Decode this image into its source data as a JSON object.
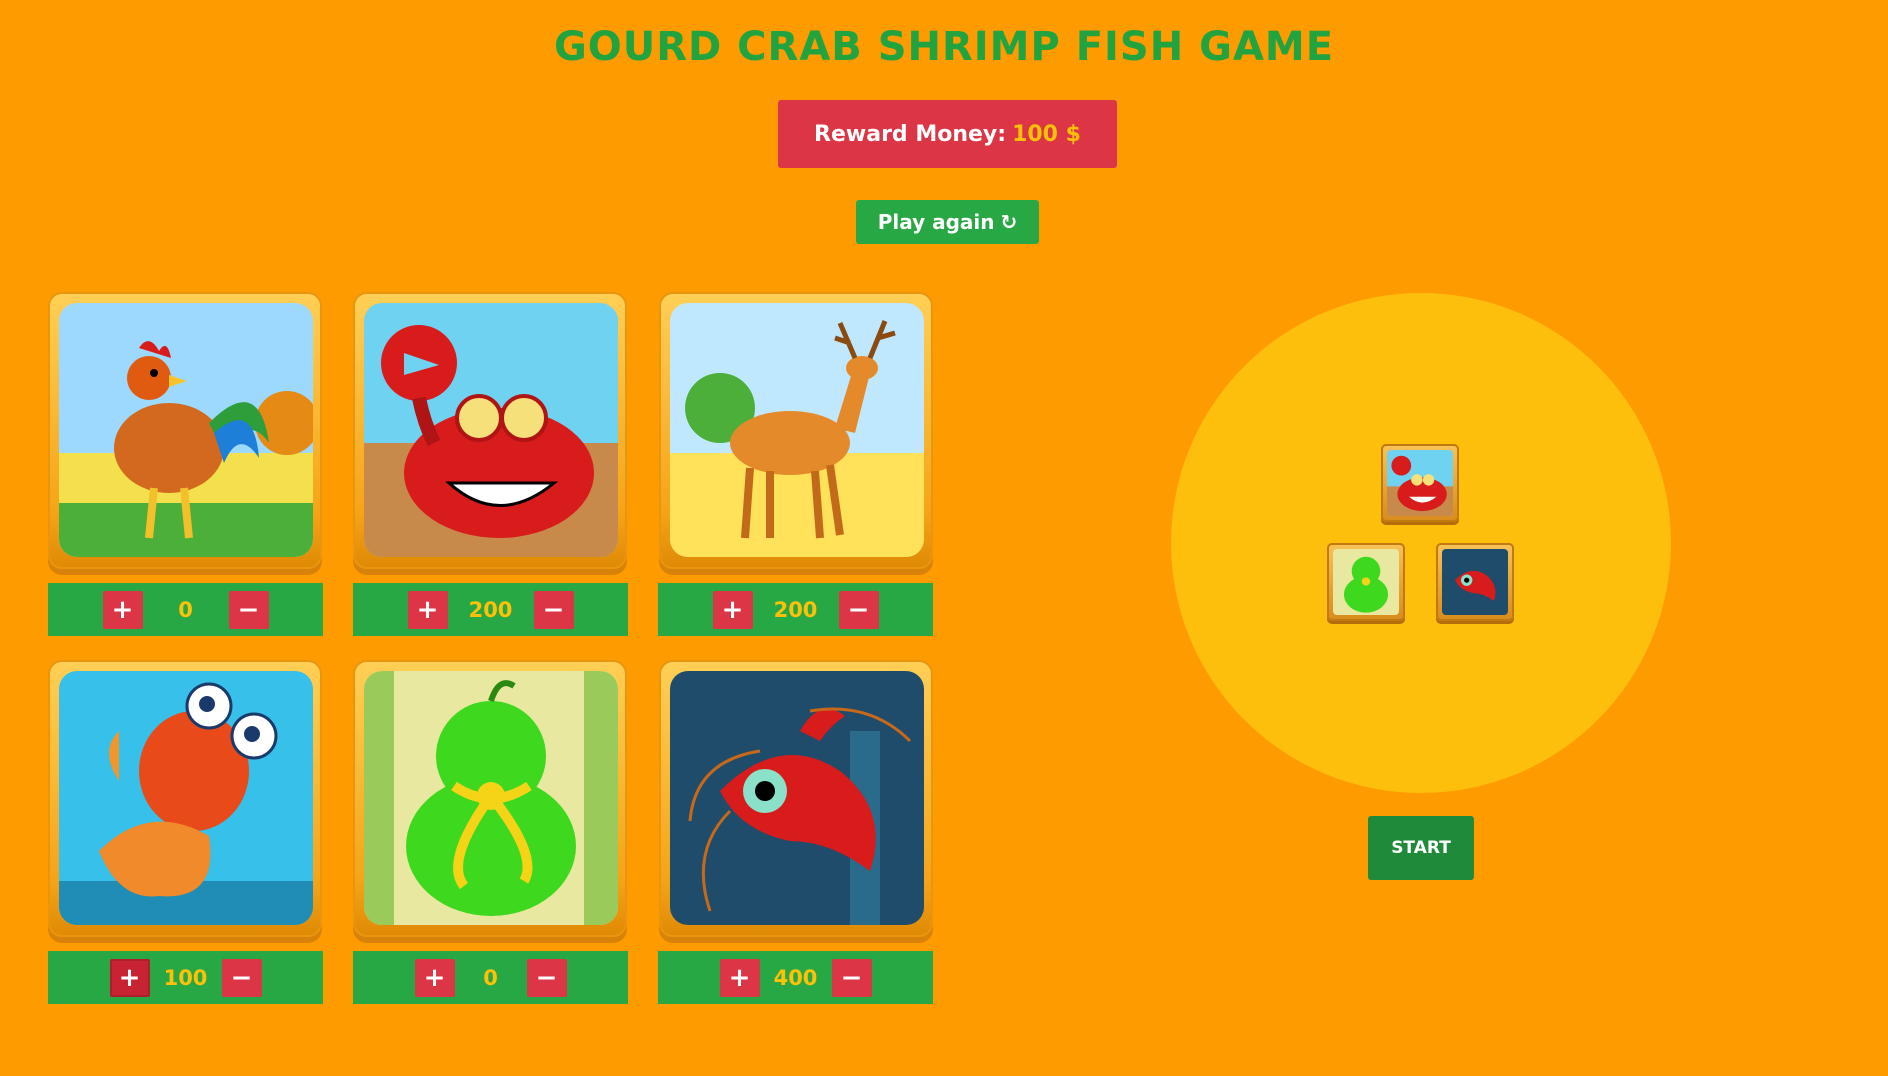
{
  "title": "GOURD CRAB SHRIMP FISH GAME",
  "reward": {
    "label": "Reward Money:",
    "amount": "100 $"
  },
  "play_again": {
    "label": "Play again",
    "icon": "refresh-icon"
  },
  "cards": [
    {
      "name": "rooster",
      "bet": "0"
    },
    {
      "name": "crab",
      "bet": "200"
    },
    {
      "name": "deer",
      "bet": "200"
    },
    {
      "name": "fish",
      "bet": "100"
    },
    {
      "name": "gourd",
      "bet": "0"
    },
    {
      "name": "shrimp",
      "bet": "400"
    }
  ],
  "controls": {
    "plus": "+",
    "minus": "−"
  },
  "dice_result": [
    "crab",
    "gourd",
    "shrimp"
  ],
  "start_label": "START",
  "colors": {
    "background": "#fe9b00",
    "title": "#21a33f",
    "reward_bg": "#dc3545",
    "amount": "#ffc107",
    "button_green": "#28a745",
    "plate": "#fdbe0c"
  }
}
